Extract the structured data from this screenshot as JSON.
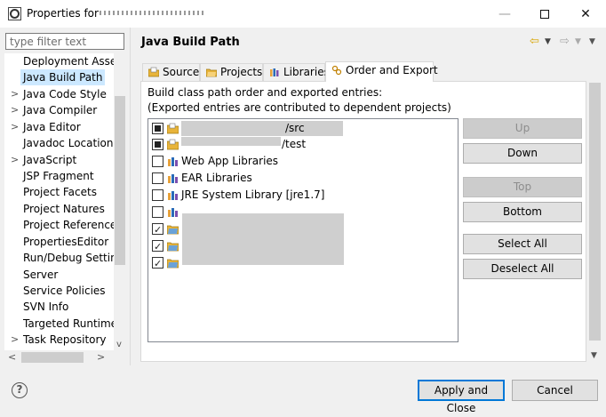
{
  "window": {
    "title_prefix": "Properties for",
    "minimize": "—",
    "close": "✕"
  },
  "filter": {
    "placeholder": "type filter text"
  },
  "tree": {
    "items": [
      {
        "label": "Deployment Assembly",
        "expandable": false
      },
      {
        "label": "Java Build Path",
        "expandable": false,
        "selected": true
      },
      {
        "label": "Java Code Style",
        "expandable": true
      },
      {
        "label": "Java Compiler",
        "expandable": true
      },
      {
        "label": "Java Editor",
        "expandable": true
      },
      {
        "label": "Javadoc Location",
        "expandable": false
      },
      {
        "label": "JavaScript",
        "expandable": true
      },
      {
        "label": "JSP Fragment",
        "expandable": false
      },
      {
        "label": "Project Facets",
        "expandable": false
      },
      {
        "label": "Project Natures",
        "expandable": false
      },
      {
        "label": "Project References",
        "expandable": false
      },
      {
        "label": "PropertiesEditor",
        "expandable": false
      },
      {
        "label": "Run/Debug Settings",
        "expandable": false
      },
      {
        "label": "Server",
        "expandable": false
      },
      {
        "label": "Service Policies",
        "expandable": false
      },
      {
        "label": "SVN Info",
        "expandable": false
      },
      {
        "label": "Targeted Runtimes",
        "expandable": false
      },
      {
        "label": "Task Repository",
        "expandable": true
      }
    ],
    "expand_glyph": ">",
    "scroll_down": "v",
    "scroll_left": "<",
    "scroll_right": ">"
  },
  "page": {
    "title": "Java Build Path",
    "tabs": [
      {
        "label": "Source"
      },
      {
        "label": "Projects"
      },
      {
        "label": "Libraries"
      },
      {
        "label": "Order and Export",
        "active": true
      }
    ],
    "description_line1": "Build class path order and exported entries:",
    "description_line2": "(Exported entries are contributed to dependent projects)",
    "entries": [
      {
        "label": "/src",
        "state": "square",
        "icon": "source-folder-icon"
      },
      {
        "label": "/test",
        "state": "square",
        "icon": "source-folder-icon"
      },
      {
        "label": "Web App Libraries",
        "state": "unchecked",
        "icon": "library-icon"
      },
      {
        "label": "EAR Libraries",
        "state": "unchecked",
        "icon": "library-icon"
      },
      {
        "label": "JRE System Library [jre1.7]",
        "state": "unchecked",
        "icon": "library-icon"
      },
      {
        "label": "",
        "state": "unchecked",
        "icon": "library-icon"
      },
      {
        "label": "",
        "state": "checked",
        "icon": "project-folder-icon"
      },
      {
        "label": "",
        "state": "checked",
        "icon": "project-folder-icon"
      },
      {
        "label": "",
        "state": "checked",
        "icon": "project-folder-icon"
      }
    ],
    "buttons": {
      "up": "Up",
      "down": "Down",
      "top": "Top",
      "bottom": "Bottom",
      "select_all": "Select All",
      "deselect_all": "Deselect All"
    }
  },
  "footer": {
    "help": "?",
    "apply_close": "Apply and Close",
    "cancel": "Cancel"
  },
  "colors": {
    "selection": "#cce8ff",
    "default_button_border": "#0078d7",
    "folder": "#e8b43a",
    "library": "#2a6bb8"
  }
}
